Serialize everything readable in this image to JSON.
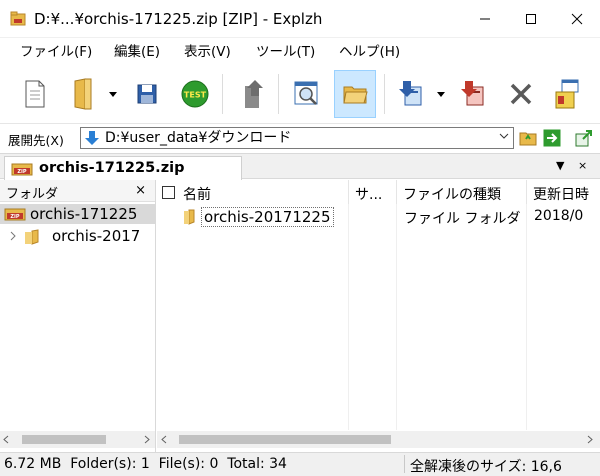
{
  "window": {
    "title": "D:¥...¥orchis-171225.zip [ZIP] - Explzh"
  },
  "menu": [
    {
      "label": "ファイル(F)"
    },
    {
      "label": "編集(E)"
    },
    {
      "label": "表示(V)"
    },
    {
      "label": "ツール(T)"
    },
    {
      "label": "ヘルプ(H)"
    }
  ],
  "toolbar": {
    "buttons": [
      {
        "icon": "new-archive-icon"
      },
      {
        "icon": "open-folder-icon"
      },
      {
        "icon": "save-icon"
      },
      {
        "icon": "test-icon",
        "text": "TEST"
      },
      {
        "icon": "up-folder-icon"
      },
      {
        "icon": "view-icon"
      },
      {
        "icon": "folder-view-icon"
      },
      {
        "icon": "extract-icon"
      },
      {
        "icon": "add-files-icon"
      },
      {
        "icon": "delete-icon"
      },
      {
        "icon": "install-icon"
      }
    ]
  },
  "address": {
    "label": "展開先(X)",
    "path": "D:¥user_data¥ダウンロード"
  },
  "tab": {
    "label": "orchis-171225.zip",
    "controls": [
      "▼",
      "×"
    ]
  },
  "folder_pane": {
    "header": "フォルダ",
    "close": "×",
    "tree": [
      {
        "label": "orchis-171225",
        "selected": true
      },
      {
        "label": "orchis-2017",
        "selected": false
      }
    ]
  },
  "file_list": {
    "columns": [
      "名前",
      "サ...",
      "ファイルの種類",
      "更新日時"
    ],
    "rows": [
      {
        "name": "orchis-20171225",
        "size": "",
        "type": "ファイル フォルダ",
        "date": "2018/0"
      }
    ]
  },
  "status": {
    "left": "6.72 MB  Folder(s): 1  File(s): 0  Total: 34",
    "right": "全解凍後のサイズ: 16,6"
  },
  "colors": {
    "accent": "#cce8ff",
    "accent_border": "#99d1ff",
    "folder": "#e8b94a",
    "zip_red": "#c0392b"
  }
}
